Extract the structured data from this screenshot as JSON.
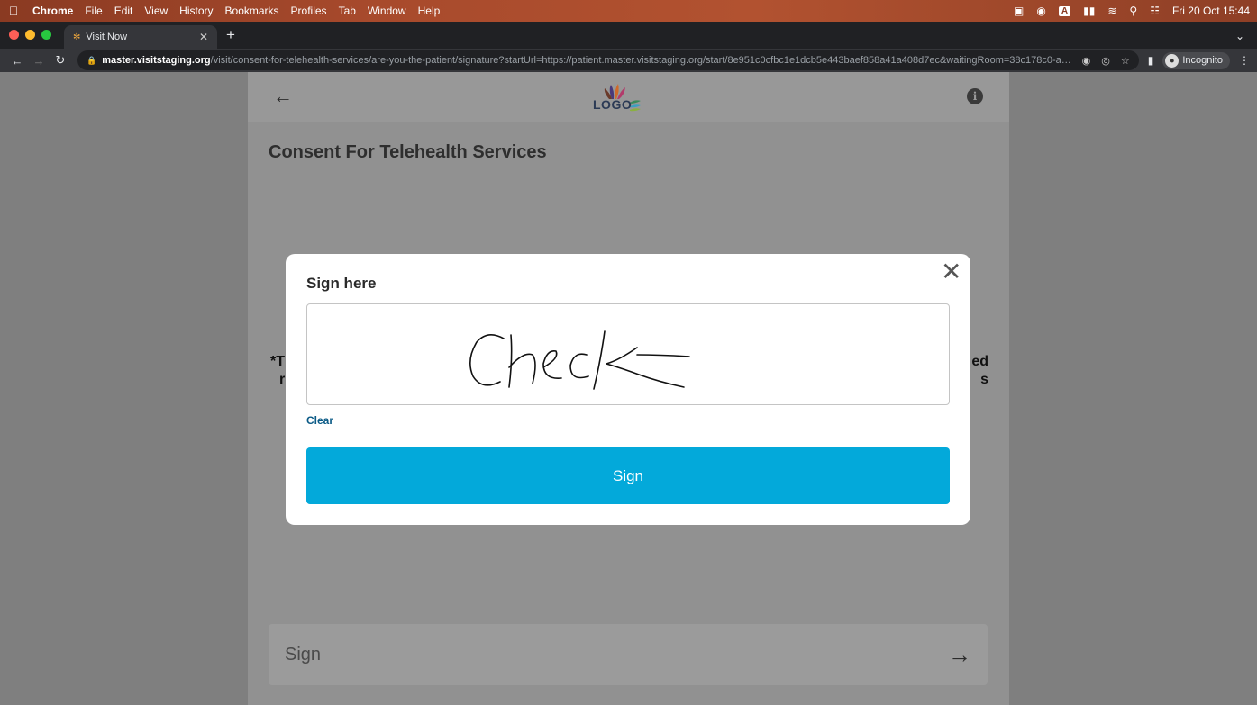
{
  "menubar": {
    "app": "Chrome",
    "items": [
      "File",
      "Edit",
      "View",
      "History",
      "Bookmarks",
      "Profiles",
      "Tab",
      "Window",
      "Help"
    ],
    "input_source": "A",
    "clock": "Fri 20 Oct  15:44"
  },
  "browser": {
    "tab_title": "Visit Now",
    "url_domain": "master.visitstaging.org",
    "url_path": "/visit/consent-for-telehealth-services/are-you-the-patient/signature?startUrl=https://patient.master.visitstaging.org/start/8e951c0cfbc1e1dcb5e443baef858a41a408d7ec&waitingRoom=38c178c0-a2f9...",
    "profile_label": "Incognito"
  },
  "page": {
    "logo_text": "LOGO",
    "title": "Consent For Telehealth Services",
    "bg_left_line1": "*T",
    "bg_left_line2": "r",
    "bg_right_line1": "ed",
    "bg_right_line2": "s",
    "bottom_sign_label": "Sign"
  },
  "modal": {
    "title": "Sign here",
    "clear_label": "Clear",
    "sign_button_label": "Sign",
    "signature": "Check"
  },
  "colors": {
    "accent": "#03a9da",
    "link": "#0a5a86",
    "overlay": "#7f7f7f"
  }
}
